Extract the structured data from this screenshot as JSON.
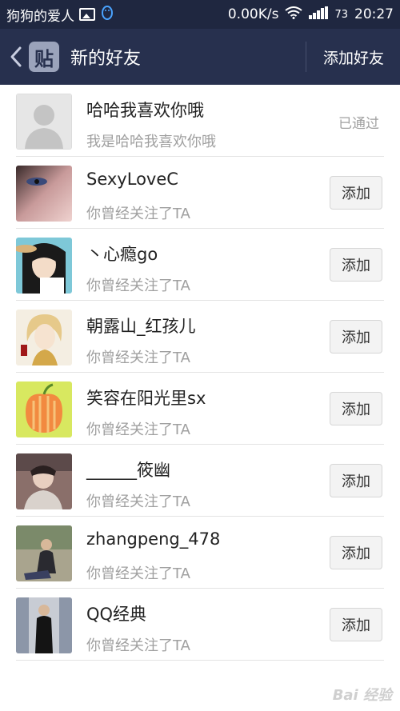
{
  "status_bar": {
    "app_name": "狗狗的爱人",
    "speed": "0.00K/s",
    "battery": "73",
    "time": "20:27"
  },
  "nav": {
    "logo_text": "贴",
    "title": "新的好友",
    "add_friend": "添加好友"
  },
  "friends": [
    {
      "name": "哈哈我喜欢你哦",
      "subtitle": "我是哈哈我喜欢你哦",
      "status": "已通过",
      "avatar": "default-avatar"
    },
    {
      "name": "SexyLoveC",
      "subtitle": "你曾经关注了TA",
      "action": "添加",
      "avatar": "eye-portrait"
    },
    {
      "name": "丶心瘾go",
      "subtitle": "你曾经关注了TA",
      "action": "添加",
      "avatar": "anime-girl"
    },
    {
      "name": "朝露山_红孩儿",
      "subtitle": "你曾经关注了TA",
      "action": "添加",
      "avatar": "anime-boy"
    },
    {
      "name": "笑容在阳光里sx",
      "subtitle": "你曾经关注了TA",
      "action": "添加",
      "avatar": "apple"
    },
    {
      "name": "______筱幽",
      "subtitle": "你曾经关注了TA",
      "action": "添加",
      "avatar": "person-photo"
    },
    {
      "name": "zhangpeng_478",
      "subtitle": "你曾经关注了TA",
      "action": "添加",
      "avatar": "person-sitting"
    },
    {
      "name": "QQ经典",
      "subtitle": "你曾经关注了TA",
      "action": "添加",
      "avatar": "person-suit"
    }
  ],
  "watermark": "Bai 经验",
  "colors": {
    "header_bg": "#27304e",
    "statusbar_bg": "#1f2740",
    "secondary_text": "#a0a0a0"
  }
}
